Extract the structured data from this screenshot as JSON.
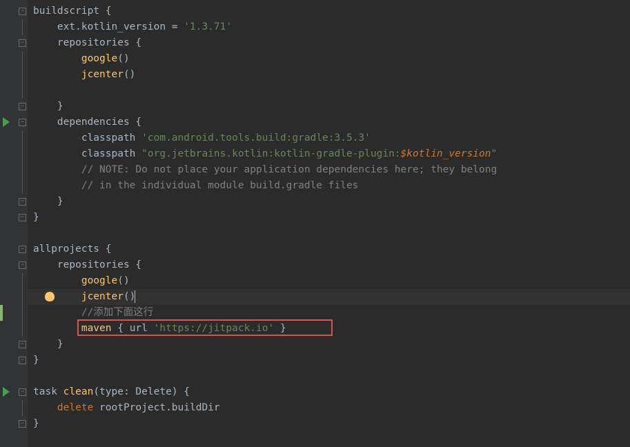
{
  "code": {
    "lines": [
      {
        "indent": 0,
        "segments": [
          {
            "cls": "identifier",
            "text": "buildscript"
          },
          {
            "cls": "brace",
            "text": " {"
          }
        ],
        "foldMinus": true
      },
      {
        "indent": 1,
        "segments": [
          {
            "cls": "identifier",
            "text": "ext."
          },
          {
            "cls": "identifier",
            "text": "kotlin_version"
          },
          {
            "cls": "brace",
            "text": " = "
          },
          {
            "cls": "string",
            "text": "'1.3.71'"
          }
        ],
        "foldLine": true
      },
      {
        "indent": 1,
        "segments": [
          {
            "cls": "identifier",
            "text": "repositories"
          },
          {
            "cls": "brace",
            "text": " {"
          }
        ],
        "foldMinus": true
      },
      {
        "indent": 2,
        "segments": [
          {
            "cls": "method",
            "text": "google"
          },
          {
            "cls": "brace",
            "text": "()"
          }
        ],
        "foldLine": true
      },
      {
        "indent": 2,
        "segments": [
          {
            "cls": "method",
            "text": "jcenter"
          },
          {
            "cls": "brace",
            "text": "()"
          }
        ],
        "foldLine": true
      },
      {
        "indent": 2,
        "segments": [],
        "foldLine": true
      },
      {
        "indent": 1,
        "segments": [
          {
            "cls": "brace",
            "text": "}"
          }
        ],
        "foldMinus": true
      },
      {
        "indent": 1,
        "segments": [
          {
            "cls": "identifier",
            "text": "dependencies"
          },
          {
            "cls": "brace",
            "text": " {"
          }
        ],
        "foldMinus": true,
        "playIcon": true
      },
      {
        "indent": 2,
        "segments": [
          {
            "cls": "identifier",
            "text": "classpath "
          },
          {
            "cls": "string",
            "text": "'com.android.tools.build:gradle:3.5.3'"
          }
        ],
        "foldLine": true
      },
      {
        "indent": 2,
        "segments": [
          {
            "cls": "identifier",
            "text": "classpath "
          },
          {
            "cls": "string",
            "text": "\"org.jetbrains.kotlin:kotlin-gradle-plugin:"
          },
          {
            "cls": "variable",
            "text": "$kotlin_version"
          },
          {
            "cls": "string",
            "text": "\""
          }
        ],
        "foldLine": true
      },
      {
        "indent": 2,
        "segments": [
          {
            "cls": "comment",
            "text": "// NOTE: Do not place your application dependencies here; they belong"
          }
        ],
        "foldLine": true
      },
      {
        "indent": 2,
        "segments": [
          {
            "cls": "comment",
            "text": "// in the individual module build.gradle files"
          }
        ],
        "foldLine": true
      },
      {
        "indent": 1,
        "segments": [
          {
            "cls": "brace",
            "text": "}"
          }
        ],
        "foldMinus": true
      },
      {
        "indent": 0,
        "segments": [
          {
            "cls": "brace",
            "text": "}"
          }
        ],
        "foldMinus": true
      },
      {
        "indent": 0,
        "segments": []
      },
      {
        "indent": 0,
        "segments": [
          {
            "cls": "identifier",
            "text": "allprojects"
          },
          {
            "cls": "brace",
            "text": " {"
          }
        ],
        "foldMinus": true
      },
      {
        "indent": 1,
        "segments": [
          {
            "cls": "identifier",
            "text": "repositories"
          },
          {
            "cls": "brace",
            "text": " {"
          }
        ],
        "foldMinus": true
      },
      {
        "indent": 2,
        "segments": [
          {
            "cls": "method",
            "text": "google"
          },
          {
            "cls": "brace",
            "text": "()"
          }
        ],
        "foldLine": true
      },
      {
        "indent": 2,
        "segments": [
          {
            "cls": "method",
            "text": "jcenter"
          },
          {
            "cls": "brace",
            "text": "()"
          }
        ],
        "foldLine": true,
        "highlighted": true,
        "bulb": true,
        "caret": true
      },
      {
        "indent": 2,
        "segments": [
          {
            "cls": "comment",
            "text": "//添加下面这行"
          }
        ],
        "foldLine": true,
        "changeMarker": true
      },
      {
        "indent": 2,
        "segments": [
          {
            "cls": "method",
            "text": "maven"
          },
          {
            "cls": "brace",
            "text": " { "
          },
          {
            "cls": "identifier",
            "text": "url "
          },
          {
            "cls": "string",
            "text": "'https://jitpack.io'"
          },
          {
            "cls": "brace",
            "text": " }"
          }
        ],
        "foldLine": true,
        "redBox": true
      },
      {
        "indent": 1,
        "segments": [
          {
            "cls": "brace",
            "text": "}"
          }
        ],
        "foldMinus": true
      },
      {
        "indent": 0,
        "segments": [
          {
            "cls": "brace",
            "text": "}"
          }
        ],
        "foldMinus": true
      },
      {
        "indent": 0,
        "segments": []
      },
      {
        "indent": 0,
        "segments": [
          {
            "cls": "identifier",
            "text": "task "
          },
          {
            "cls": "method",
            "text": "clean"
          },
          {
            "cls": "brace",
            "text": "("
          },
          {
            "cls": "identifier",
            "text": "type: Delete"
          },
          {
            "cls": "brace",
            "text": ") {"
          }
        ],
        "foldMinus": true,
        "playIcon": true
      },
      {
        "indent": 1,
        "segments": [
          {
            "cls": "keyword",
            "text": "delete "
          },
          {
            "cls": "identifier",
            "text": "rootProject"
          },
          {
            "cls": "brace",
            "text": "."
          },
          {
            "cls": "identifier",
            "text": "buildDir"
          }
        ],
        "foldLine": true
      },
      {
        "indent": 0,
        "segments": [
          {
            "cls": "brace",
            "text": "}"
          }
        ],
        "foldMinus": true
      }
    ]
  },
  "icons": {
    "foldMinus": "⊟",
    "foldPlus": "⊞"
  }
}
